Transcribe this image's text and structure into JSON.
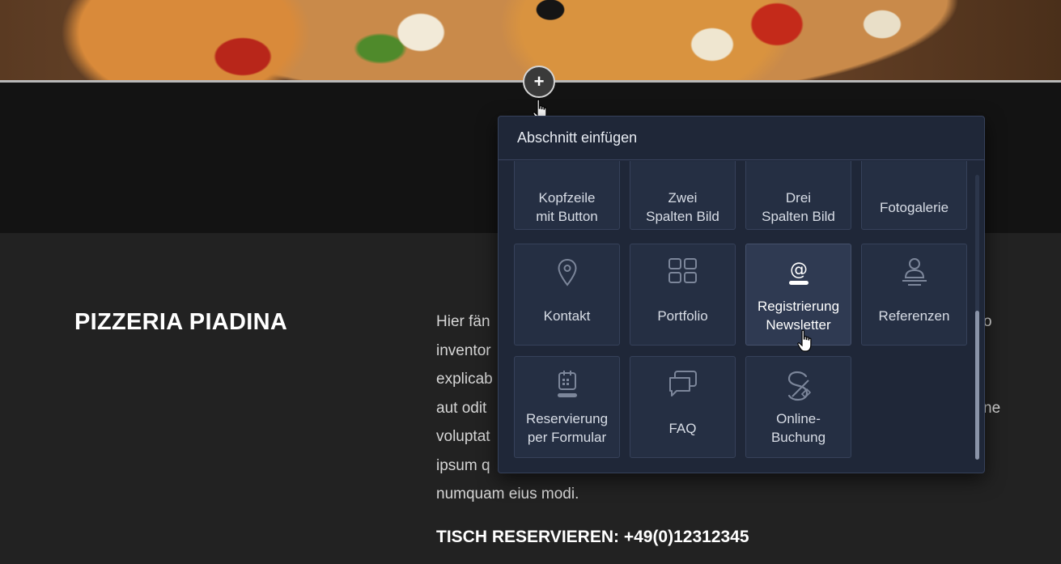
{
  "add_button": {
    "label": "+"
  },
  "intro": {
    "title": "PIZZERIA PIADINA",
    "lines": [
      "Hier fän",
      "inventor",
      "explicab",
      "aut odit",
      "voluptat",
      "ipsum q",
      "numquam eius modi."
    ],
    "right_fragments": [
      "o",
      "ne"
    ],
    "phone": "TISCH RESERVIEREN: +49(0)12312345"
  },
  "panel": {
    "title": "Abschnitt einfügen",
    "tiles": [
      {
        "name": "kopfzeile-mit-button",
        "line1": "Kopfzeile",
        "line2": "mit Button",
        "icon": "partial-icon"
      },
      {
        "name": "zwei-spalten-bild",
        "line1": "Zwei",
        "line2": "Spalten Bild",
        "icon": "partial-icon"
      },
      {
        "name": "drei-spalten-bild",
        "line1": "Drei",
        "line2": "Spalten Bild",
        "icon": "partial-icon"
      },
      {
        "name": "fotogalerie",
        "line1": "Fotogalerie",
        "line2": "",
        "icon": "partial-icon"
      },
      {
        "name": "kontakt",
        "line1": "Kontakt",
        "line2": "",
        "icon": "location-pin-icon"
      },
      {
        "name": "portfolio",
        "line1": "Portfolio",
        "line2": "",
        "icon": "grid-icon"
      },
      {
        "name": "registrierung-newsletter",
        "line1": "Registrierung",
        "line2": "Newsletter",
        "icon": "at-sign-icon",
        "active": true
      },
      {
        "name": "referenzen",
        "line1": "Referenzen",
        "line2": "",
        "icon": "person-icon"
      },
      {
        "name": "reservierung-per-formular",
        "line1": "Reservierung",
        "line2": "per Formular",
        "icon": "calendar-icon"
      },
      {
        "name": "faq",
        "line1": "FAQ",
        "line2": "",
        "icon": "chat-bubbles-icon"
      },
      {
        "name": "online-buchung",
        "line1": "Online-",
        "line2": "Buchung",
        "icon": "booking-logo-icon"
      }
    ],
    "scroll_position": 0.48
  },
  "colors": {
    "panel_bg": "#1f2738",
    "tile_bg": "#252f43",
    "tile_active_bg": "#2f3a52",
    "page_bg": "#222222"
  }
}
